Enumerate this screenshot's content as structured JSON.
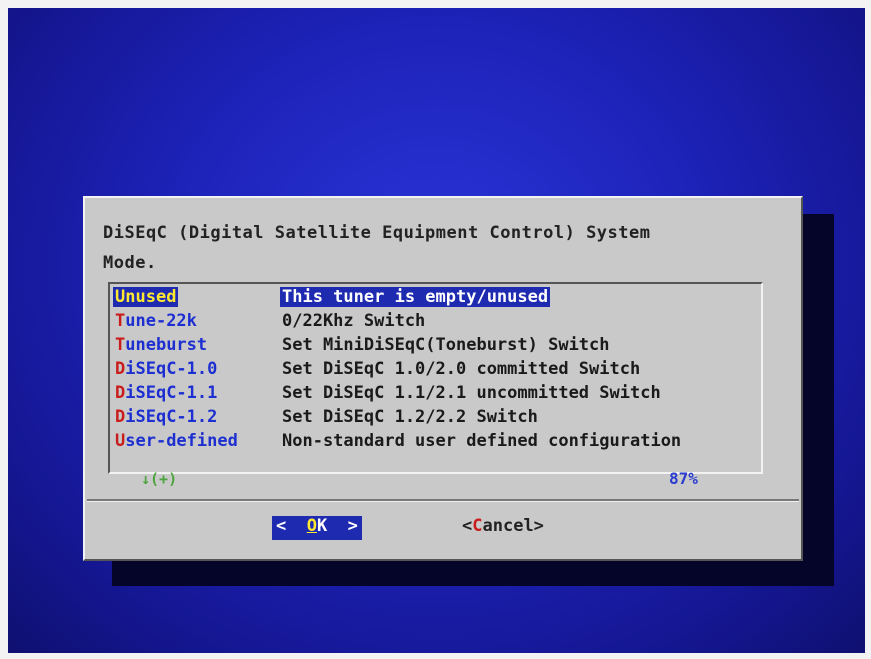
{
  "dialog": {
    "title_line1": "DiSEqC (Digital Satellite Equipment Control) System",
    "title_line2": "Mode."
  },
  "menu": {
    "items": [
      {
        "hotkey": "U",
        "rest": "nused",
        "description": "This tuner is empty/unused",
        "selected": true
      },
      {
        "hotkey": "T",
        "rest": "une-22k",
        "description": "0/22Khz Switch"
      },
      {
        "hotkey": "T",
        "rest": "uneburst",
        "description": "Set MiniDiSEqC(Toneburst) Switch"
      },
      {
        "hotkey": "D",
        "rest": "iSEqC-1.0",
        "description": "Set DiSEqC 1.0/2.0 committed Switch"
      },
      {
        "hotkey": "D",
        "rest": "iSEqC-1.1",
        "description": "Set DiSEqC 1.1/2.1 uncommitted Switch"
      },
      {
        "hotkey": "D",
        "rest": "iSEqC-1.2",
        "description": "Set DiSEqC 1.2/2.2 Switch"
      },
      {
        "hotkey": "U",
        "rest": "ser-defined",
        "description": "Non-standard user defined configuration"
      }
    ],
    "scroll_indicator": "↓(+)",
    "scroll_percent": "87%"
  },
  "buttons": {
    "ok_left": "<  ",
    "ok_hotkey": "O",
    "ok_rest": "K  >",
    "cancel_left": "<",
    "cancel_hotkey": "C",
    "cancel_rest": "ancel>"
  },
  "colors": {
    "screen_blue": "#1d22b8",
    "dialog_gray": "#c9c9c9",
    "selection_blue": "#1e2bb0",
    "hotkey_red": "#c91c1c",
    "tag_blue": "#1d2fd0",
    "selected_tag_yellow": "#ffe830",
    "scroll_green": "#4ca43c"
  }
}
